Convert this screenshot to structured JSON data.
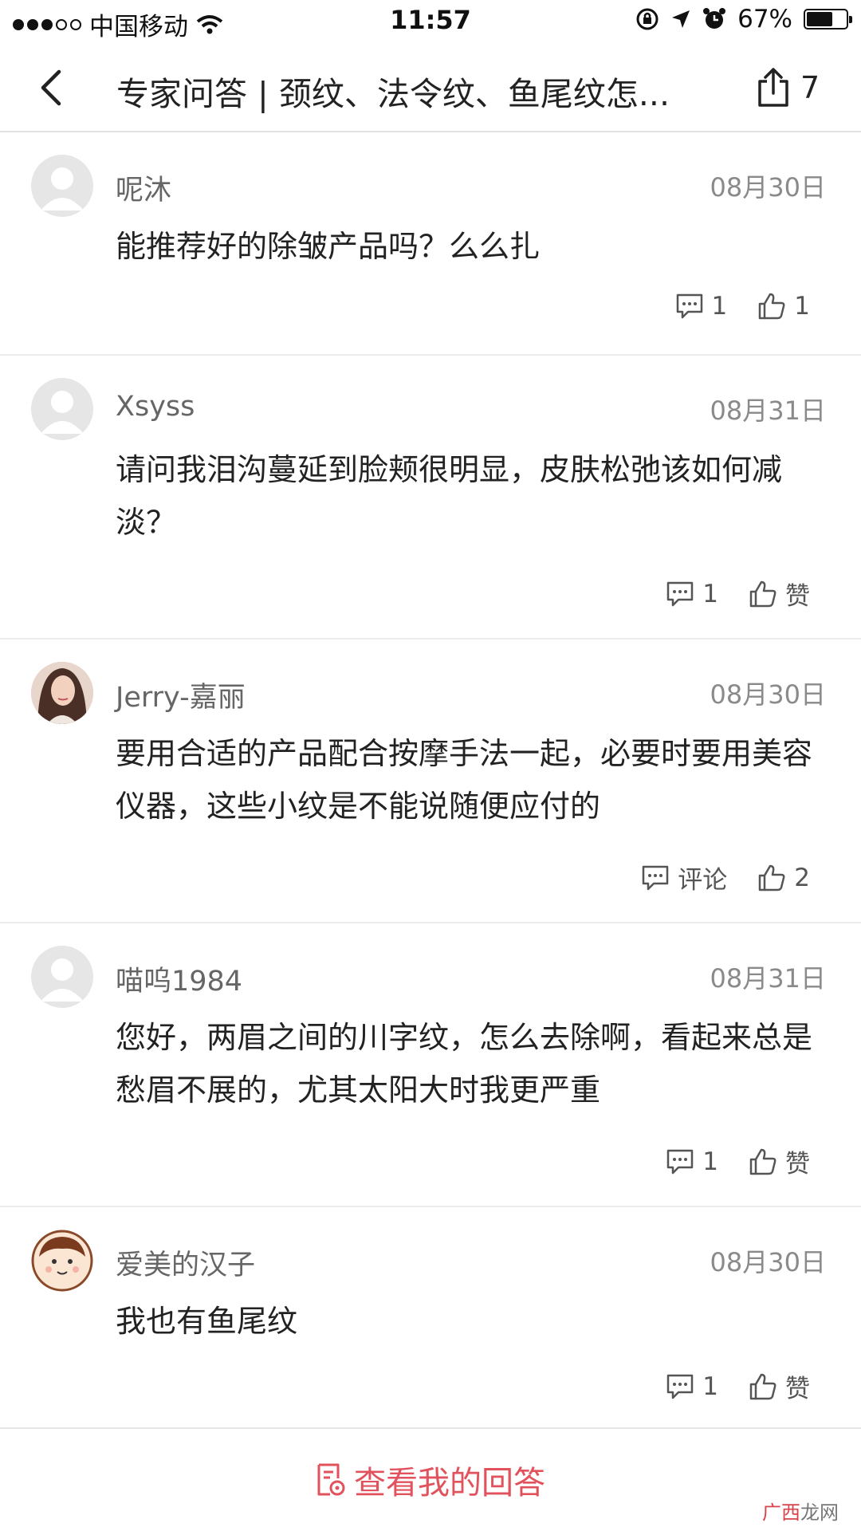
{
  "status_bar": {
    "carrier": "中国移动",
    "time": "11:57",
    "battery": "67%",
    "battery_level": 0.67
  },
  "nav": {
    "title": "专家问答 | 颈纹、法令纹、鱼尾纹怎...",
    "share_count": "7"
  },
  "comments": [
    {
      "username": "呢沐",
      "date": "08月30日",
      "text": "能推荐好的除皱产品吗？么么扎",
      "reply_label": "1",
      "like_label": "1",
      "avatar": "default-avatar"
    },
    {
      "username": "Xsyss",
      "date": "08月31日",
      "text": "请问我泪沟蔓延到脸颊很明显，皮肤松弛该如何减淡？",
      "reply_label": "1",
      "like_label": "赞",
      "avatar": "default-avatar"
    },
    {
      "username": "Jerry-嘉丽",
      "date": "08月30日",
      "text": "要用合适的产品配合按摩手法一起，必要时要用美容仪器，这些小纹是不能说随便应付的",
      "reply_label": "评论",
      "like_label": "2",
      "avatar": "photo-avatar"
    },
    {
      "username": "喵呜1984",
      "date": "08月31日",
      "text": "您好，两眉之间的川字纹，怎么去除啊，看起来总是愁眉不展的，尤其太阳大时我更严重",
      "reply_label": "1",
      "like_label": "赞",
      "avatar": "default-avatar"
    },
    {
      "username": "爱美的汉子",
      "date": "08月30日",
      "text": "我也有鱼尾纹",
      "reply_label": "1",
      "like_label": "赞",
      "avatar": "cartoon-avatar"
    }
  ],
  "bottom": {
    "label": "查看我的回答"
  },
  "watermark": {
    "part1": "广西",
    "part2": "龙网"
  },
  "colors": {
    "accent": "#e2525c",
    "text": "#222222",
    "muted": "#8a8a8a"
  }
}
